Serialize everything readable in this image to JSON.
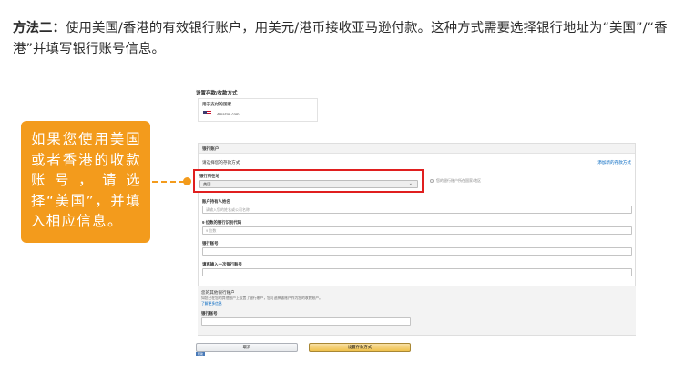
{
  "intro": {
    "lead": "方法二：",
    "text": "使用美国/香港的有效银行账户，用美元/港币接收亚马逊付款。这种方式需要选择银行地址为“美国”/“香港”并填写银行账号信息。"
  },
  "callout": {
    "text": "如果您使用美国或者香港的收款账号，请选择“美国”，并填入相应信息。"
  },
  "colors": {
    "accent": "#f39b1c",
    "highlight": "#e01f1f",
    "link": "#0066c0",
    "primary_button": "#f0c14b"
  },
  "screenshot": {
    "title": "设置存款/收款方式",
    "country_block": {
      "label": "用于支付的国家",
      "flag_icon": "us-flag-icon",
      "value": "Amazon.com"
    },
    "bank_panel": {
      "header": "银行账户",
      "subrow_label": "请选择您的存款方式",
      "subrow_link": "添加新的存款方式",
      "bank_country_label": "银行所在地",
      "bank_country_value": "美国",
      "side_hint": "您的银行账户所在国家/地区",
      "fields": [
        {
          "label": "账户持有人姓名",
          "placeholder": "请输入您的姓名或公司名称"
        },
        {
          "label": "9 位数的银行识别代码",
          "placeholder": "9 位数"
        },
        {
          "label": "银行账号",
          "placeholder": ""
        },
        {
          "label": "请再输入一次银行账号",
          "placeholder": ""
        }
      ]
    },
    "future_panel": {
      "title": "您的其他银行账户",
      "desc": "如您已在您的其他账户上设置了银行账户，您可选择该账户作为您的收款账户。",
      "link": "了解更多信息",
      "label": "银行账号"
    },
    "buttons": {
      "cancel": "取消",
      "set": "设置存款方式"
    },
    "mini_tab": "帮助"
  }
}
